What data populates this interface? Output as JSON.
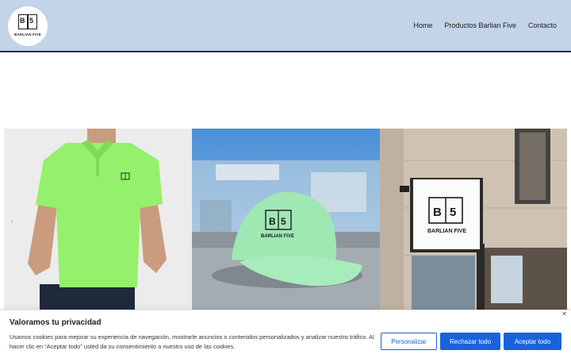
{
  "logo": {
    "letters_left": "B",
    "letters_right": "5",
    "brand": "BARLIAN FIVE"
  },
  "nav": {
    "home": "Home",
    "products": "Productos Barlian Five",
    "contact": "Contacto"
  },
  "slider": {
    "slide_2_logo_left": "B",
    "slide_2_logo_right": "5",
    "slide_2_brand": "BARLIAN FIVE",
    "slide_3_logo_left": "B",
    "slide_3_logo_right": "5",
    "slide_3_brand": "BARLIAN FIVE"
  },
  "cookie": {
    "title": "Valoramos tu privacidad",
    "text": "Usamos cookies para mejorar su experiencia de navegación, mostrarle anuncios o contenidos personalizados y analizar nuestro tráfico. Al hacer clic en “Aceptar todo” usted da su consentimiento a nuestro uso de las cookies.",
    "customize": "Personalizar",
    "reject": "Rechazar todo",
    "accept": "Aceptar todo",
    "close": "✕"
  },
  "colors": {
    "header_bg": "#c3d3e8",
    "accent": "#1863dc",
    "header_border": "#1f2a7a"
  }
}
